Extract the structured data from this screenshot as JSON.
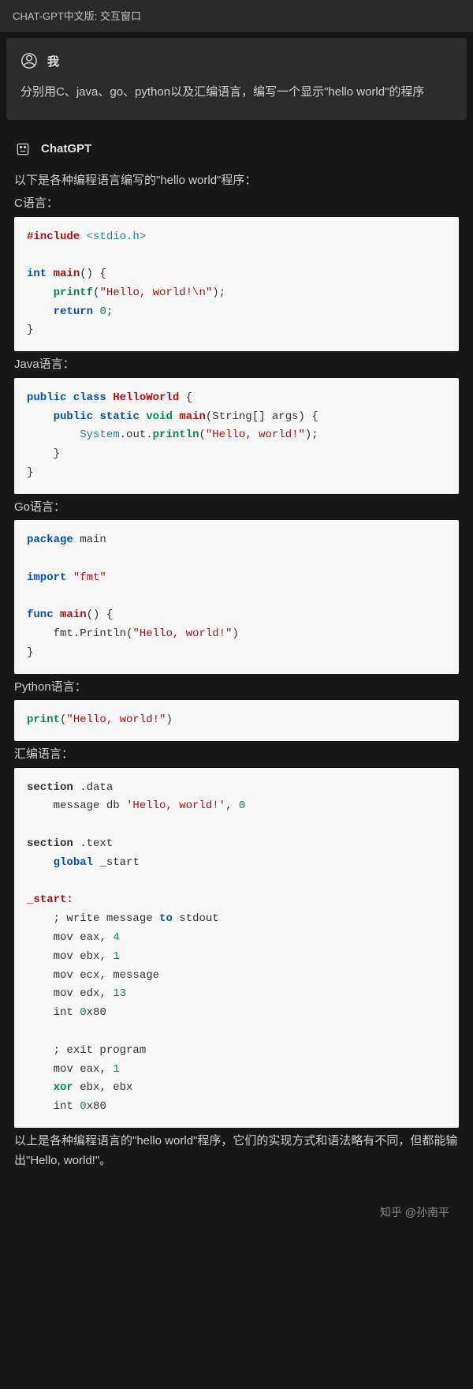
{
  "window": {
    "title": "CHAT-GPT中文版: 交互窗口"
  },
  "user": {
    "label": "我",
    "message": "分别用C、java、go、python以及汇编语言，编写一个显示\"hello world\"的程序"
  },
  "assistant": {
    "label": "ChatGPT",
    "intro": "以下是各种编程语言编写的\"hello world\"程序：",
    "languages": [
      {
        "label": "C语言："
      },
      {
        "label": "Java语言："
      },
      {
        "label": "Go语言："
      },
      {
        "label": "Python语言："
      },
      {
        "label": "汇编语言："
      }
    ],
    "code": {
      "c_include": "#include",
      "c_header": "<stdio.h>",
      "c_int": "int",
      "c_main": "main",
      "c_printf": "printf",
      "c_str": "\"Hello, world!\\n\"",
      "c_return": "return",
      "c_zero": "0",
      "java_public": "public",
      "java_class": "class",
      "java_name": "HelloWorld",
      "java_static": "static",
      "java_void": "void",
      "java_main": "main",
      "java_args": "(String[] args)",
      "java_sys": "System",
      "java_out": ".out.",
      "java_println": "println",
      "java_str": "\"Hello, world!\"",
      "go_pkg": "package",
      "go_main": "main",
      "go_import": "import",
      "go_fmt": "\"fmt\"",
      "go_func": "func",
      "go_println": "fmt.Println",
      "go_str": "\"Hello, world!\"",
      "py_print": "print",
      "py_str": "\"Hello, world!\"",
      "asm_section": "section",
      "asm_data": ".data",
      "asm_msg": "message db",
      "asm_hello": "'Hello, world!'",
      "asm_zero": "0",
      "asm_text": ".text",
      "asm_global": "global",
      "asm_start": "_start",
      "asm_startlbl": "_start:",
      "asm_c1": "; write message",
      "asm_to": "to",
      "asm_stdout": "stdout",
      "asm_mov": "mov",
      "asm_eax": "eax,",
      "asm_4": "4",
      "asm_ebx": "ebx,",
      "asm_1": "1",
      "asm_ecx": "ecx, message",
      "asm_edx": "edx,",
      "asm_13": "13",
      "asm_int": "int",
      "asm_0x80": "0",
      "asm_x80": "x80",
      "asm_c2": "; exit program",
      "asm_xor": "xor",
      "asm_ebxebx": "ebx, ebx"
    },
    "outro": "以上是各种编程语言的\"hello world\"程序，它们的实现方式和语法略有不同，但都能输出\"Hello, world!\"。"
  },
  "footer": {
    "text": "知乎 @孙南平"
  }
}
